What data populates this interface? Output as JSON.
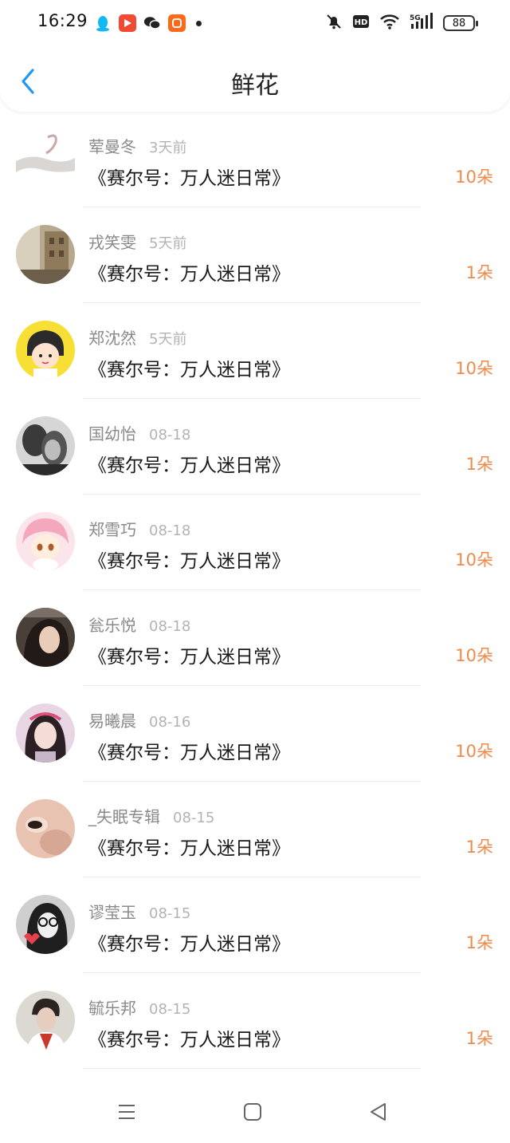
{
  "status_bar": {
    "time": "16:29",
    "app_icons": [
      "penguin-icon",
      "video-play-icon",
      "wechat-icon",
      "taobao-icon"
    ],
    "battery": "88",
    "network": "5G",
    "hd": "HD"
  },
  "header": {
    "title": "鲜花",
    "back_icon": "chevron-left-icon",
    "accent": "#2196F3"
  },
  "list": [
    {
      "name": "荤曼冬",
      "date": "3天前",
      "book": "《赛尔号：万人迷日常》",
      "count": "10朵"
    },
    {
      "name": "戎笑雯",
      "date": "5天前",
      "book": "《赛尔号：万人迷日常》",
      "count": "1朵"
    },
    {
      "name": "郑沈然",
      "date": "5天前",
      "book": "《赛尔号：万人迷日常》",
      "count": "10朵"
    },
    {
      "name": "国幼怡",
      "date": "08-18",
      "book": "《赛尔号：万人迷日常》",
      "count": "1朵"
    },
    {
      "name": "郑雪巧",
      "date": "08-18",
      "book": "《赛尔号：万人迷日常》",
      "count": "10朵"
    },
    {
      "name": "瓮乐悦",
      "date": "08-18",
      "book": "《赛尔号：万人迷日常》",
      "count": "10朵"
    },
    {
      "name": "易曦晨",
      "date": "08-16",
      "book": "《赛尔号：万人迷日常》",
      "count": "10朵"
    },
    {
      "name": "_失眠专辑",
      "date": "08-15",
      "book": "《赛尔号：万人迷日常》",
      "count": "1朵"
    },
    {
      "name": "谬莹玉",
      "date": "08-15",
      "book": "《赛尔号：万人迷日常》",
      "count": "1朵"
    },
    {
      "name": "毓乐邦",
      "date": "08-15",
      "book": "《赛尔号：万人迷日常》",
      "count": "1朵"
    }
  ],
  "nav_bar": {
    "icons": [
      "menu-icon",
      "home-square-icon",
      "back-triangle-icon"
    ]
  },
  "colors": {
    "count": "#f08a4b",
    "name": "#8a8a8a",
    "date": "#b3b3b3"
  }
}
